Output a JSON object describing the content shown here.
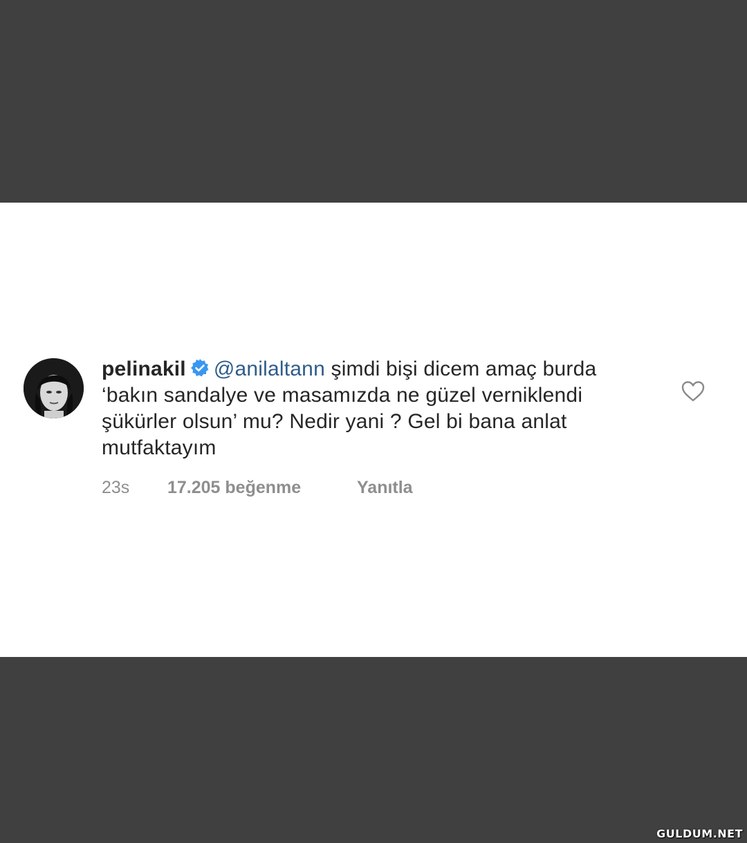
{
  "comment": {
    "username": "pelinakil",
    "mention": "@anilaltann",
    "text": " şimdi bişi dicem amaç burda ‘bakın sandalye ve masamızda ne güzel verniklendi şükürler olsun’ mu? Nedir yani ? Gel bi bana anlat mutfaktayım",
    "time": "23s",
    "likes": "17.205 beğenme",
    "reply_label": "Yanıtla"
  },
  "icons": {
    "verified": "verified-badge-icon",
    "like": "heart-outline-icon"
  },
  "colors": {
    "background_band": "#404040",
    "card": "#ffffff",
    "text": "#262626",
    "mention": "#2f5c8a",
    "meta": "#8e8e8e",
    "verified": "#3897f0"
  },
  "watermark": "GULDUM.NET"
}
